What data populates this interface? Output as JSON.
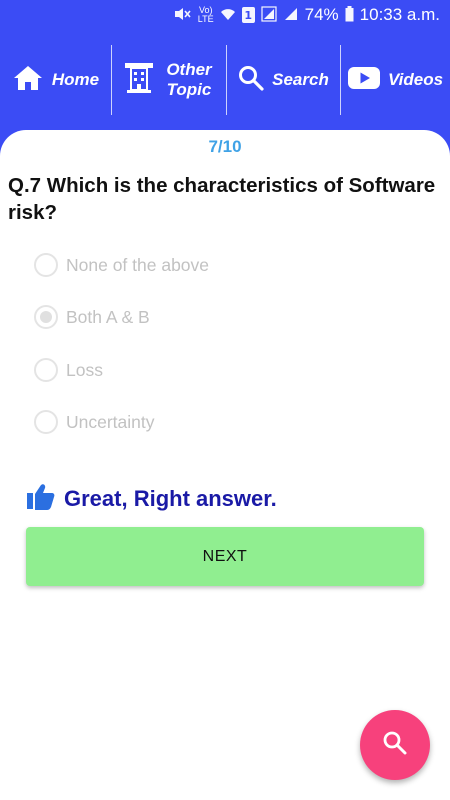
{
  "status_bar": {
    "battery": "74%",
    "time": "10:33 a.m.",
    "volte_label": "Vo)\nLTE",
    "sim_label": "1"
  },
  "nav": {
    "home": "Home",
    "other_topic": "Other Topic",
    "search": "Search",
    "videos": "Videos"
  },
  "quiz": {
    "counter": "7/10",
    "question": "Q.7 Which is the characteristics of Software risk?",
    "options": [
      {
        "label": "None of the above",
        "selected": false
      },
      {
        "label": "Both A & B",
        "selected": true
      },
      {
        "label": "Loss",
        "selected": false
      },
      {
        "label": "Uncertainty",
        "selected": false
      }
    ],
    "feedback": "Great, Right answer.",
    "next_label": "NEXT"
  },
  "colors": {
    "primary": "#3b4cf5",
    "counter": "#3fa2e6",
    "feedback": "#1a1aa6",
    "next_button": "#90ee90",
    "fab": "#f7417c"
  },
  "icons": {
    "home": "home-icon",
    "other_topic": "building-icon",
    "search": "search-icon",
    "videos": "youtube-play-icon",
    "feedback": "thumbs-up-icon",
    "fab": "search-icon"
  }
}
